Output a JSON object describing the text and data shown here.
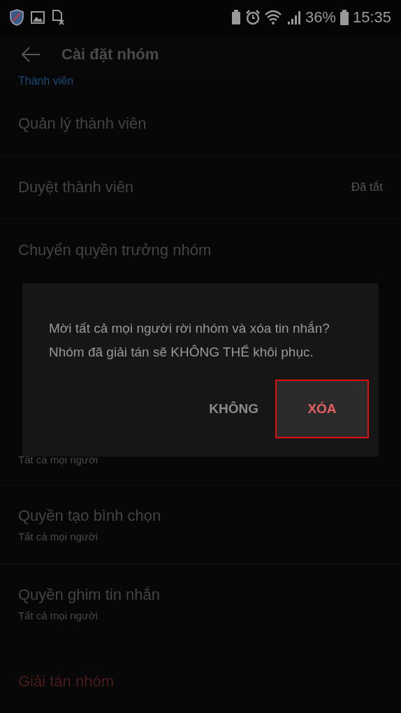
{
  "status_bar": {
    "battery_text": "36%",
    "time": "15:35"
  },
  "app_bar": {
    "title": "Cài đặt nhóm"
  },
  "sections": [
    {
      "header": "Thành viên",
      "items": [
        {
          "title": "Quản lý thành viên",
          "kind": "plain"
        },
        {
          "title": "Duyệt thành viên",
          "value": "Đã tắt",
          "kind": "plain"
        },
        {
          "title": "Chuyển quyền trưởng nhóm",
          "kind": "plain"
        }
      ]
    },
    {
      "items": [
        {
          "subtitle": "Tất cả mọi người",
          "kind": "partial"
        },
        {
          "title": "Quyền tạo bình chọn",
          "subtitle": "Tất cả mọi người",
          "kind": "plain"
        },
        {
          "title": "Quyền ghim tin nhắn",
          "subtitle": "Tất cả mọi người",
          "kind": "plain"
        }
      ]
    },
    {
      "items": [
        {
          "title": "Giải tán nhóm",
          "kind": "danger"
        }
      ]
    }
  ],
  "dialog": {
    "message": "Mời tất cả mọi người rời nhóm và xóa tin nhắn? Nhóm đã giải tán sẽ KHÔNG THỂ khôi phục.",
    "buttons": [
      {
        "label": "KHÔNG",
        "kind": "neutral",
        "highlighted": false
      },
      {
        "label": "XÓA",
        "kind": "destructive",
        "highlighted": true
      }
    ]
  }
}
